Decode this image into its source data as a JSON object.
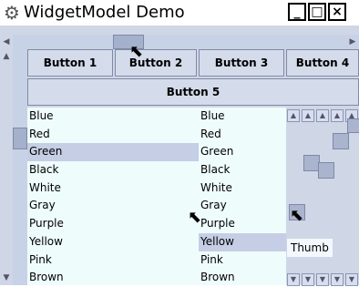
{
  "window": {
    "title": "WidgetModel Demo",
    "icon": "app-icon",
    "controls": [
      "_",
      "□",
      "×"
    ]
  },
  "buttons": {
    "row": [
      "Button 1",
      "Button 2",
      "Button 3",
      "Button 4"
    ],
    "button5": "Button 5"
  },
  "lists": {
    "left": [
      "Blue",
      "Red",
      "Green",
      "Black",
      "White",
      "Gray",
      "Purple",
      "Yellow",
      "Pink",
      "Brown"
    ],
    "right": [
      "Blue",
      "Red",
      "Green",
      "Black",
      "White",
      "Gray",
      "Purple",
      "Yellow",
      "Pink",
      "Brown"
    ],
    "left_selected": "Green",
    "right_selected": "Yellow"
  },
  "panel": {
    "tooltip": "Thumb"
  },
  "colors": {
    "window_bg": "#cfd6e6",
    "list_bg": "#effcfc",
    "selection": "#c5cee4",
    "scroll_thumb": "#a4b0cc"
  }
}
